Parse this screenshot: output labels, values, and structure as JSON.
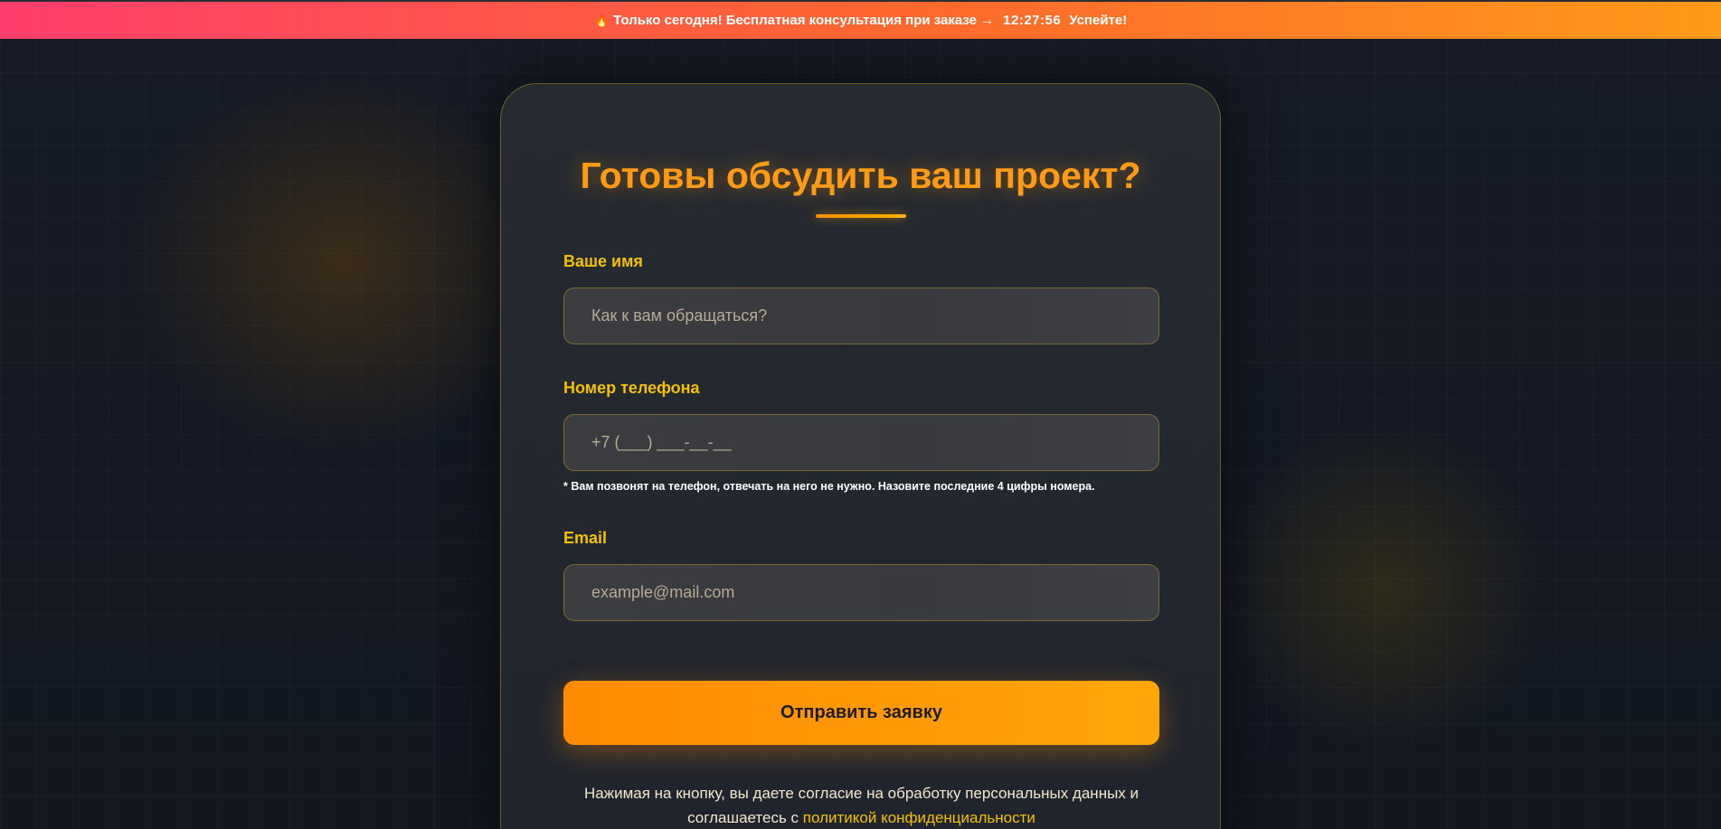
{
  "promo": {
    "fire_icon": "🔥",
    "text": "Только сегодня! Бесплатная консультация при заказе →",
    "timer": "12:27:56",
    "cta": "Успейте!"
  },
  "form": {
    "title": "Готовы обсудить ваш проект?",
    "name_label": "Ваше имя",
    "name_placeholder": "Как к вам обращаться?",
    "phone_label": "Номер телефона",
    "phone_placeholder": "+7 (___) ___-__-__",
    "phone_hint": "* Вам позвонят на телефон, отвечать на него не нужно. Назовите последние 4 цифры номера.",
    "email_label": "Email",
    "email_placeholder": "example@mail.com",
    "submit_label": "Отправить заявку",
    "consent_text": "Нажимая на кнопку, вы даете согласие на обработку персональных данных и соглашаетесь с",
    "privacy_link": "политикой конфиденциальности"
  },
  "colors": {
    "accent": "#ff9a14",
    "label": "#f5c000",
    "promo_gradient_start": "#ff3d6e",
    "promo_gradient_end": "#ff9a1a"
  }
}
